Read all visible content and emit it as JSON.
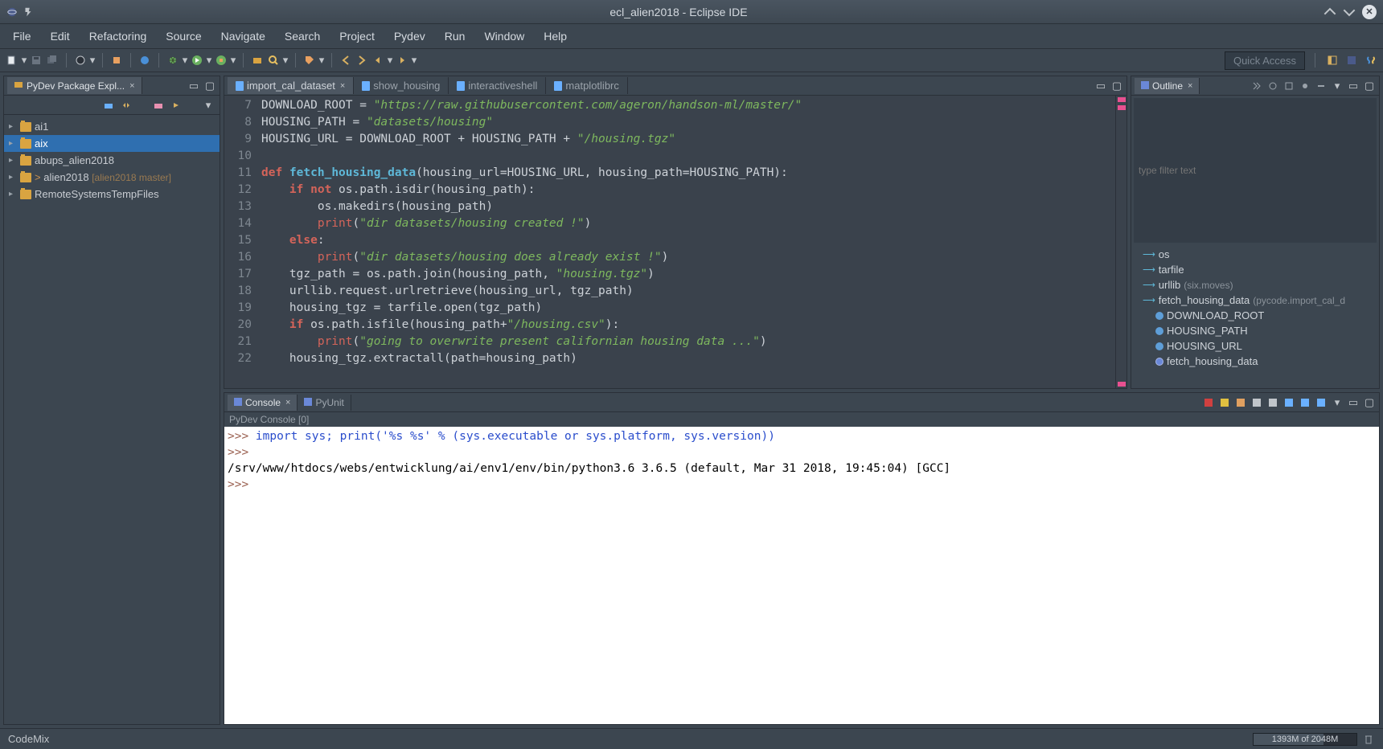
{
  "window": {
    "title": "ecl_alien2018 - Eclipse IDE"
  },
  "menu": {
    "items": [
      "File",
      "Edit",
      "Refactoring",
      "Source",
      "Navigate",
      "Search",
      "Project",
      "Pydev",
      "Run",
      "Window",
      "Help"
    ]
  },
  "toolbar": {
    "quick_access": "Quick Access"
  },
  "pkg_explorer": {
    "title": "PyDev Package Expl...",
    "items": [
      {
        "label": "ai1",
        "selected": false
      },
      {
        "label": "aix",
        "selected": true
      },
      {
        "label": "abups_alien2018",
        "selected": false
      },
      {
        "label": "alien2018",
        "branch": "[alien2018 master]",
        "dirty": true,
        "selected": false
      },
      {
        "label": "RemoteSystemsTempFiles",
        "selected": false
      }
    ]
  },
  "editor": {
    "tabs": [
      {
        "label": "import_cal_dataset",
        "active": true,
        "icon": "py"
      },
      {
        "label": "show_housing",
        "active": false,
        "icon": "py"
      },
      {
        "label": "interactiveshell",
        "active": false,
        "icon": "py"
      },
      {
        "label": "matplotlibrc",
        "active": false,
        "icon": "txt"
      }
    ],
    "lines": [
      {
        "n": 7,
        "html": "DOWNLOAD_ROOT = <span class='k-str'>\"https://raw.githubusercontent.com/ageron/handson-ml/master/\"</span>"
      },
      {
        "n": 8,
        "html": "HOUSING_PATH = <span class='k-str'>\"datasets/housing\"</span>"
      },
      {
        "n": 9,
        "html": "HOUSING_URL = DOWNLOAD_ROOT + HOUSING_PATH + <span class='k-str'>\"/housing.tgz\"</span>"
      },
      {
        "n": 10,
        "html": ""
      },
      {
        "n": 11,
        "html": "<span class='k-key'>def</span> <span class='k-def'>fetch_housing_data</span>(housing_url=HOUSING_URL, housing_path=HOUSING_PATH):"
      },
      {
        "n": 12,
        "html": "    <span class='k-key'>if</span> <span class='k-key'>not</span> os.path.isdir(housing_path):"
      },
      {
        "n": 13,
        "html": "        os.makedirs(housing_path)"
      },
      {
        "n": 14,
        "html": "        <span class='k-bp'>print</span>(<span class='k-str'>\"dir datasets/housing created !\"</span>)"
      },
      {
        "n": 15,
        "html": "    <span class='k-key'>else</span>:"
      },
      {
        "n": 16,
        "html": "        <span class='k-bp'>print</span>(<span class='k-str'>\"dir datasets/housing does already exist !\"</span>)"
      },
      {
        "n": 17,
        "html": "    tgz_path = os.path.join(housing_path, <span class='k-str'>\"housing.tgz\"</span>)"
      },
      {
        "n": 18,
        "html": "    urllib.request.urlretrieve(housing_url, tgz_path)"
      },
      {
        "n": 19,
        "html": "    housing_tgz = tarfile.open(tgz_path)"
      },
      {
        "n": 20,
        "html": "    <span class='k-key'>if</span> os.path.isfile(housing_path+<span class='k-str'>\"/housing.csv\"</span>):"
      },
      {
        "n": 21,
        "html": "        <span class='k-bp'>print</span>(<span class='k-str'>\"going to overwrite present californian housing data ...\"</span>)"
      },
      {
        "n": 22,
        "html": "    housing_tgz.extractall(path=housing_path)"
      }
    ]
  },
  "outline": {
    "title": "Outline",
    "filter_placeholder": "type filter text",
    "items": [
      {
        "label": "os",
        "type": "import"
      },
      {
        "label": "tarfile",
        "type": "import"
      },
      {
        "label": "urllib",
        "suffix": "(six.moves)",
        "type": "import"
      },
      {
        "label": "fetch_housing_data",
        "suffix": "(pycode.import_cal_d",
        "type": "import"
      },
      {
        "label": "DOWNLOAD_ROOT",
        "type": "const"
      },
      {
        "label": "HOUSING_PATH",
        "type": "const"
      },
      {
        "label": "HOUSING_URL",
        "type": "const"
      },
      {
        "label": "fetch_housing_data",
        "type": "func"
      }
    ]
  },
  "console": {
    "tabs": [
      {
        "label": "Console",
        "active": true
      },
      {
        "label": "PyUnit",
        "active": false
      }
    ],
    "label": "PyDev Console [0]",
    "lines": [
      {
        "prompt": ">>> ",
        "text": "import sys; print('%s %s' % (sys.executable or sys.platform, sys.version))",
        "cmd": true
      },
      {
        "prompt": ">>> ",
        "text": "",
        "cmd": true
      },
      {
        "prompt": "",
        "text": "/srv/www/htdocs/webs/entwicklung/ai/env1/env/bin/python3.6 3.6.5 (default, Mar 31 2018, 19:45:04) [GCC]",
        "cmd": false
      },
      {
        "prompt": ">>> ",
        "text": "",
        "cmd": true
      }
    ]
  },
  "status": {
    "left": "CodeMix",
    "heap": "1393M of 2048M"
  }
}
